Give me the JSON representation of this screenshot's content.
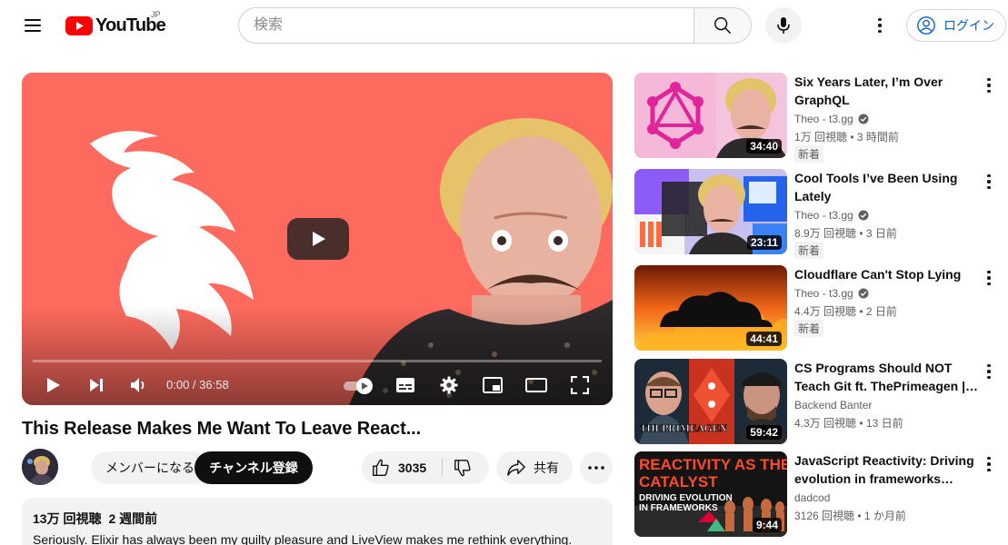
{
  "header": {
    "logo_text": "YouTube",
    "region": "JP",
    "search_placeholder": "検索",
    "signin_label": "ログイン",
    "icons": [
      "hamburger-menu-icon",
      "youtube-logo",
      "search-icon",
      "mic-icon",
      "kebab-menu-icon",
      "account-icon"
    ]
  },
  "player": {
    "time_current": "0:00",
    "time_separator": " / ",
    "time_total": "36:58",
    "progress_fraction": 0,
    "autoplay_on": true,
    "icons": [
      "play-icon",
      "next-icon",
      "volume-icon",
      "autoplay-toggle",
      "subtitles-icon",
      "settings-icon",
      "miniplayer-icon",
      "theater-icon",
      "fullscreen-icon"
    ]
  },
  "video": {
    "title": "This Release Makes Me Want To Leave React...",
    "member_label": "メンバーになる",
    "subscribe_label": "チャンネル登録",
    "like_count": "3035",
    "share_label": "共有",
    "description": {
      "views": "13万 回視聴",
      "date": "2 週間前",
      "text": "Seriously. Elixir has always been my guilty pleasure and LiveView makes me rethink everything."
    }
  },
  "recommendations": [
    {
      "title": "Six Years Later, I’m Over GraphQL",
      "channel": "Theo - t3.gg",
      "verified": true,
      "views": "1万 回視聴",
      "age": "3 時間前",
      "badge": "新着",
      "duration": "34:40"
    },
    {
      "title": "Cool Tools I’ve Been Using Lately",
      "channel": "Theo - t3.gg",
      "verified": true,
      "views": "8.9万 回視聴",
      "age": "3 日前",
      "badge": "新着",
      "duration": "23:11"
    },
    {
      "title": "Cloudflare Can't Stop Lying",
      "channel": "Theo - t3.gg",
      "verified": true,
      "views": "4.4万 回視聴",
      "age": "2 日前",
      "badge": "新着",
      "duration": "44:41"
    },
    {
      "title": "CS Programs Should NOT Teach Git ft. ThePrimeagen | Backen…",
      "channel": "Backend Banter",
      "verified": false,
      "views": "4.3万 回視聴",
      "age": "13 日前",
      "badge": "",
      "duration": "59:42",
      "thumb_text": "THEPRIMEAGEN"
    },
    {
      "title": "JavaScript Reactivity: Driving evolution in frameworks #reac…",
      "channel": "dadcod",
      "verified": false,
      "views": "3126 回視聴",
      "age": "1 か月前",
      "badge": "",
      "duration": "9:44",
      "thumb_text_1": "REACTIVITY AS THE",
      "thumb_text_2": "CATALYST",
      "thumb_text_3": "DRIVING EVOLUTION",
      "thumb_text_4": "IN FRAMEWORKS"
    }
  ],
  "separator_dot": " • ",
  "colors": {
    "brand_red": "#ff0000",
    "link_blue": "#065fd4",
    "player_bg": "#ff6a5e",
    "chip_bg": "#f2f2f2"
  }
}
